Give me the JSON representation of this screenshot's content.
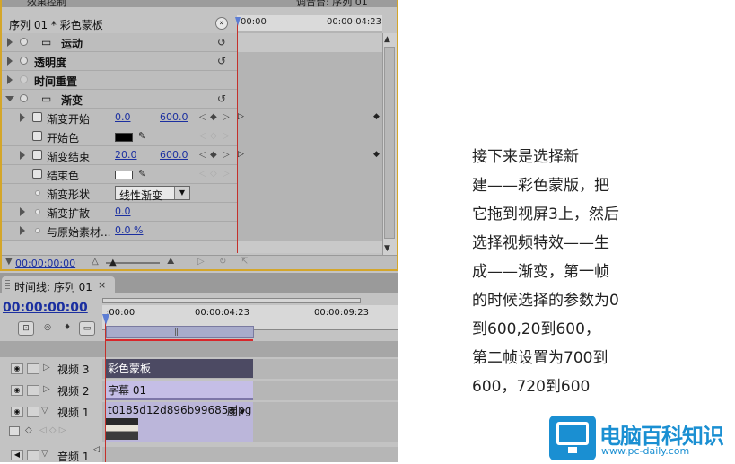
{
  "effect_controls": {
    "top_tabs": [
      "效果控制",
      "调音台: 序列 01"
    ],
    "sequence_title": "序列 01 * 彩色蒙板",
    "ruler_start": "00:00",
    "ruler_end": "00:00:04:23",
    "bottom_time": "00:00:00:00",
    "effects": [
      {
        "name": "运动",
        "expanded": false
      },
      {
        "name": "透明度",
        "expanded": false
      },
      {
        "name": "时间重置",
        "expanded": false
      },
      {
        "name": "渐变",
        "expanded": true
      }
    ],
    "params": {
      "ramp_start": {
        "label": "渐变开始",
        "x": "0.0",
        "y": "600.0"
      },
      "start_color": {
        "label": "开始色",
        "color": "#000000"
      },
      "ramp_end": {
        "label": "渐变结束",
        "x": "20.0",
        "y": "600.0"
      },
      "end_color": {
        "label": "结束色",
        "color": "#ffffff"
      },
      "ramp_shape": {
        "label": "渐变形状",
        "value": "线性渐变"
      },
      "ramp_scatter": {
        "label": "渐变扩散",
        "value": "0.0"
      },
      "blend": {
        "label": "与原始素材...",
        "value": "0.0 %"
      }
    }
  },
  "timeline": {
    "tab_label": "时间线: 序列 01",
    "close": "×",
    "current_time": "00:00:00:00",
    "ruler_labels": [
      ":00:00",
      "00:00:04:23",
      "00:00:09:23"
    ],
    "tracks": [
      {
        "name": "视频 3",
        "clip": "彩色蒙板"
      },
      {
        "name": "视频 2",
        "clip": "字幕 01"
      },
      {
        "name": "视频 1",
        "clip": "t0185d12d896b99685ajpg",
        "clip_extra": "度 ▾"
      },
      {
        "name": "音频 1",
        "clip": ""
      }
    ]
  },
  "article": {
    "lines": [
      "接下来是选择新",
      "建——彩色蒙版，把",
      "它拖到视屏3上，然后",
      "选择视频特效——生",
      "成——渐变，第一帧",
      "的时候选择的参数为0",
      "到600,20到600，",
      "第二帧设置为700到",
      "600，720到600"
    ]
  },
  "watermark": {
    "title": "电脑百科知识",
    "url": "www.pc-daily.com"
  },
  "colors": {
    "panel_bg": "#c3c3c3",
    "panel_border": "#d4a62a",
    "value_blue": "#1b2fa0",
    "playhead_red": "#c4302b",
    "clip_dark": "#4c4a63",
    "clip_light": "#c5bee6",
    "brand_blue": "#1a8fd2"
  }
}
